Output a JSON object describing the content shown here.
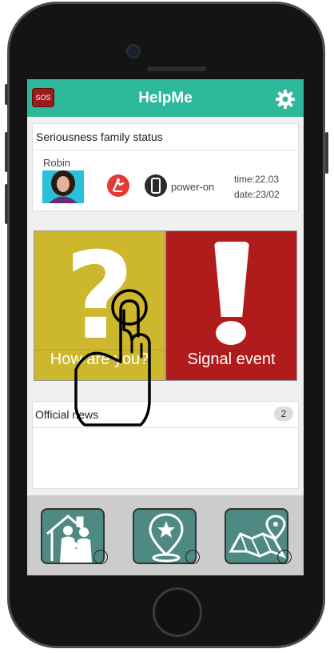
{
  "header": {
    "sos_label": "SOS",
    "title": "HelpMe",
    "settings_icon": "gear-icon"
  },
  "family": {
    "title": "Seriousness family status",
    "member": {
      "name": "Robin",
      "device_state": "power-on",
      "time": "time:22.03",
      "date": "date:23/02",
      "status_icons": [
        "fall-alert-icon",
        "phone-device-icon"
      ]
    }
  },
  "actions": {
    "how": {
      "label": "How are you?",
      "icon": "question-mark-icon",
      "color": "#cdb82d"
    },
    "signal": {
      "label": "Signal event",
      "icon": "exclamation-icon",
      "color": "#b01c1c"
    }
  },
  "news": {
    "title": "Official news",
    "count": "2"
  },
  "nav": {
    "items": [
      "family-house-icon",
      "map-location-star-icon",
      "map-route-icon"
    ]
  },
  "colors": {
    "accent": "#2db89b",
    "sos": "#9e1b1b",
    "nav_bg": "#4e8a83"
  }
}
